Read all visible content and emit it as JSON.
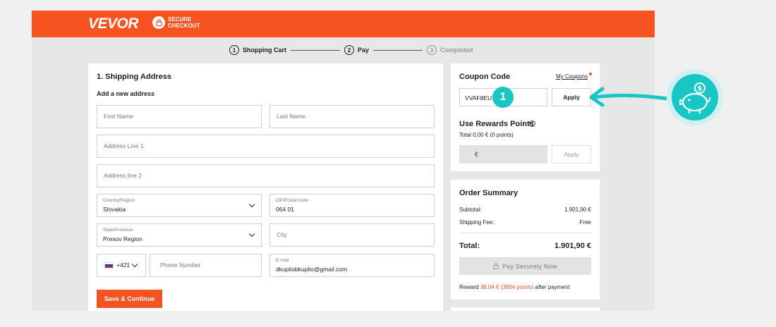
{
  "header": {
    "logo": "VEVOR",
    "secure_line1": "SECURE",
    "secure_line2": "CHECKOUT"
  },
  "steps": [
    {
      "num": "1",
      "label": "Shopping Cart"
    },
    {
      "num": "2",
      "label": "Pay"
    },
    {
      "num": "3",
      "label": "Completed"
    }
  ],
  "shipping": {
    "title": "1. Shipping Address",
    "subtitle": "Add a new address",
    "first_name_ph": "First Name",
    "last_name_ph": "Last Name",
    "address1_ph": "Address Line 1",
    "address2_ph": "Address line 2",
    "country_label": "Country/Region",
    "country_value": "Slovakia",
    "zip_label": "ZIP/Postal code",
    "zip_value": "064 01",
    "state_label": "State/Province",
    "state_value": "Presov Region",
    "city_ph": "City",
    "phone_code": "+421",
    "phone_ph": "Phone Number",
    "email_label": "E-mail",
    "email_value": "dkupliobkuplio@gmail.com",
    "save_label": "Save & Continue"
  },
  "coupon": {
    "title": "Coupon Code",
    "my_coupons": "My Coupons",
    "code_value": "VVAF8EU",
    "apply_label": "Apply",
    "rewards_title": "Use Rewards Points",
    "rewards_total": "Total 0,00 € (0 points)",
    "rewards_currency": "€",
    "rewards_apply": "Apply"
  },
  "summary": {
    "title": "Order Summary",
    "subtotal_label": "Subtotal:",
    "subtotal_value": "1.901,90 €",
    "shipping_label": "Shipping Fee:",
    "shipping_value": "Free",
    "total_label": "Total:",
    "total_value": "1.901,90 €",
    "pay_label": "Pay Securely Now",
    "reward_prefix": "Reward",
    "reward_amount": "38,04 € (3804 points)",
    "reward_suffix": "after payment"
  },
  "annotation": {
    "badge": "1",
    "coin_symbol": "$"
  },
  "colors": {
    "brand": "#f75321",
    "accent": "#19c6c6"
  }
}
